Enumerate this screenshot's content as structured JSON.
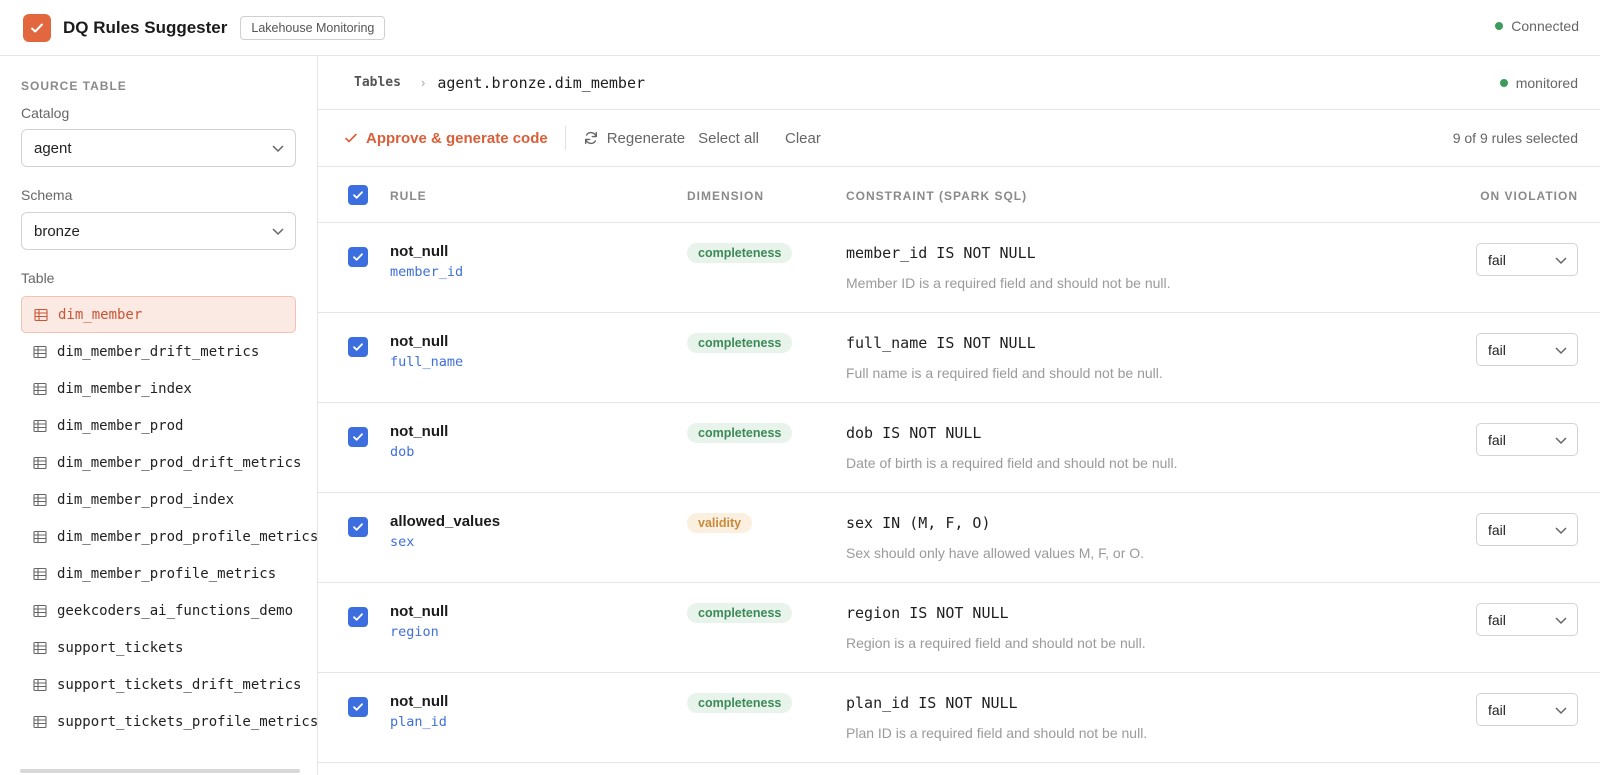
{
  "app": {
    "title": "DQ Rules Suggester",
    "badge": "Lakehouse Monitoring",
    "status": "Connected",
    "accent": "#e2673f"
  },
  "sidebar": {
    "heading": "SOURCE TABLE",
    "catalog_label": "Catalog",
    "catalog_value": "agent",
    "schema_label": "Schema",
    "schema_value": "bronze",
    "table_label": "Table",
    "tables": [
      {
        "name": "dim_member",
        "active": true
      },
      {
        "name": "dim_member_drift_metrics"
      },
      {
        "name": "dim_member_index"
      },
      {
        "name": "dim_member_prod"
      },
      {
        "name": "dim_member_prod_drift_metrics"
      },
      {
        "name": "dim_member_prod_index"
      },
      {
        "name": "dim_member_prod_profile_metrics"
      },
      {
        "name": "dim_member_profile_metrics"
      },
      {
        "name": "geekcoders_ai_functions_demo"
      },
      {
        "name": "support_tickets"
      },
      {
        "name": "support_tickets_drift_metrics"
      },
      {
        "name": "support_tickets_profile_metrics"
      }
    ]
  },
  "breadcrumb": {
    "root": "Tables",
    "separator": "›",
    "current": "agent.bronze.dim_member",
    "status": "monitored"
  },
  "toolbar": {
    "approve_label": "Approve & generate code",
    "regenerate_label": "Regenerate",
    "select_all_label": "Select all",
    "clear_label": "Clear",
    "selection_count": "9 of 9 rules selected"
  },
  "columns": {
    "rule": "RULE",
    "dimension": "DIMENSION",
    "constraint": "CONSTRAINT (SPARK SQL)",
    "on_violation": "ON VIOLATION"
  },
  "rules": [
    {
      "name": "not_null",
      "column": "member_id",
      "dimension": "completeness",
      "constraint": "member_id IS NOT NULL",
      "description": "Member ID is a required field and should not be null.",
      "on_violation": "fail",
      "checked": true
    },
    {
      "name": "not_null",
      "column": "full_name",
      "dimension": "completeness",
      "constraint": "full_name IS NOT NULL",
      "description": "Full name is a required field and should not be null.",
      "on_violation": "fail",
      "checked": true
    },
    {
      "name": "not_null",
      "column": "dob",
      "dimension": "completeness",
      "constraint": "dob IS NOT NULL",
      "description": "Date of birth is a required field and should not be null.",
      "on_violation": "fail",
      "checked": true
    },
    {
      "name": "allowed_values",
      "column": "sex",
      "dimension": "validity",
      "constraint": "sex IN (M, F, O)",
      "description": "Sex should only have allowed values M, F, or O.",
      "on_violation": "fail",
      "checked": true
    },
    {
      "name": "not_null",
      "column": "region",
      "dimension": "completeness",
      "constraint": "region IS NOT NULL",
      "description": "Region is a required field and should not be null.",
      "on_violation": "fail",
      "checked": true
    },
    {
      "name": "not_null",
      "column": "plan_id",
      "dimension": "completeness",
      "constraint": "plan_id IS NOT NULL",
      "description": "Plan ID is a required field and should not be null.",
      "on_violation": "fail",
      "checked": true
    }
  ]
}
